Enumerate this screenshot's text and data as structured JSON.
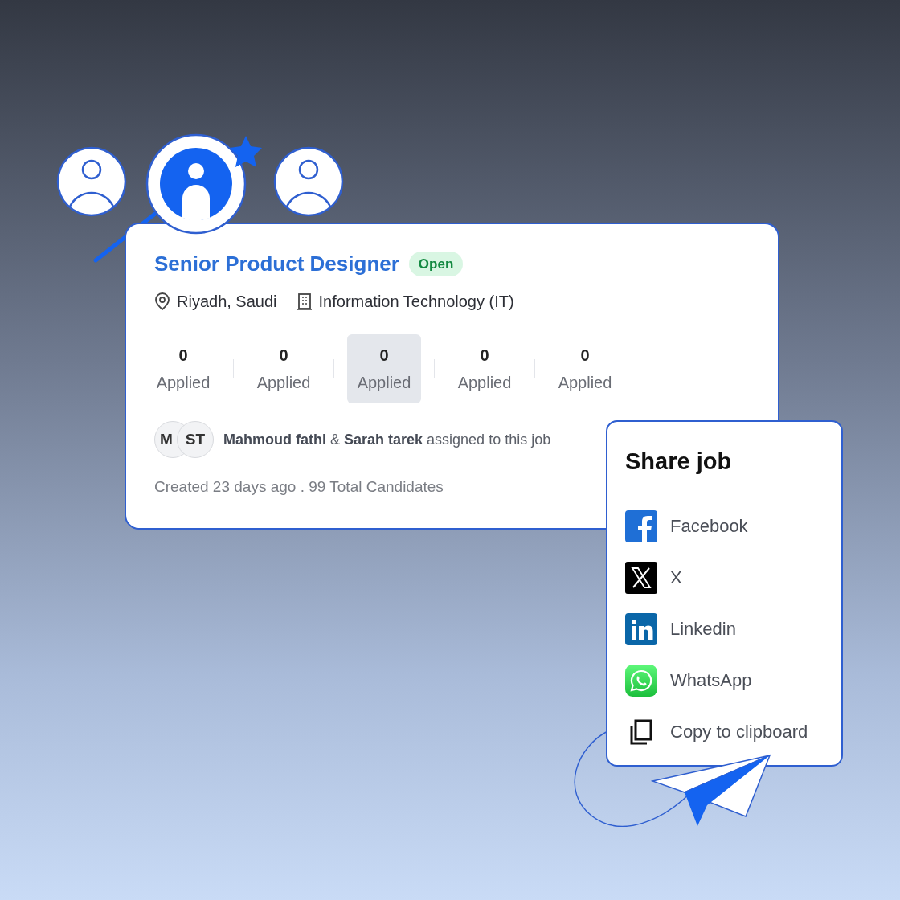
{
  "job": {
    "title": "Senior Product Designer",
    "status": "Open",
    "location": "Riyadh, Saudi",
    "industry": "Information Technology (IT)"
  },
  "stats": [
    {
      "value": "0",
      "label": "Applied",
      "selected": false
    },
    {
      "value": "0",
      "label": "Applied",
      "selected": false
    },
    {
      "value": "0",
      "label": "Applied",
      "selected": true
    },
    {
      "value": "0",
      "label": "Applied",
      "selected": false
    },
    {
      "value": "0",
      "label": "Applied",
      "selected": false
    }
  ],
  "assignees": {
    "initials": [
      "M",
      "ST"
    ],
    "text": "**Mahmoud fathi** & **Sarah tarek** assigned to this job"
  },
  "footer": "Created 23 days ago . 99 Total Candidates",
  "share": {
    "title": "Share job",
    "items": [
      {
        "kind": "facebook",
        "label": "Facebook"
      },
      {
        "kind": "x",
        "label": "X"
      },
      {
        "kind": "linkedin",
        "label": "Linkedin"
      },
      {
        "kind": "whatsapp",
        "label": "WhatsApp"
      },
      {
        "kind": "copy",
        "label": "Copy to clipboard"
      }
    ]
  }
}
